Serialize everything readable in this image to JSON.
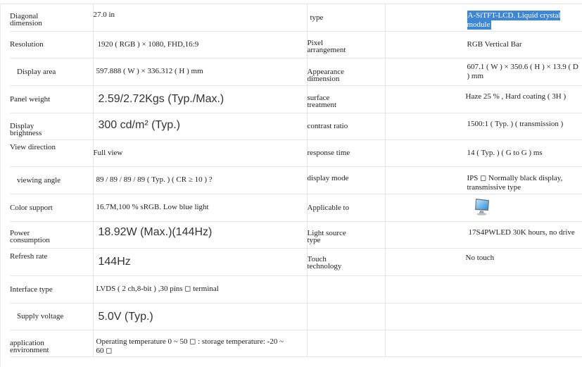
{
  "rows": [
    {
      "k1": "Diagonal\ndimension",
      "v2": "27.0 in",
      "k3": "type",
      "v4": "A-SiTFT-LCD. Liquid crystal module"
    },
    {
      "k1": "Resolution",
      "v2": "1920 ( RGB ) × 1080, FHD,16:9",
      "k3": "Pixel\narrangement",
      "v4": "RGB Vertical Bar"
    },
    {
      "k1": "Display area",
      "v2": "597.888 ( W ) × 336.312 ( H ) mm",
      "k3": "Appearance\ndimension",
      "v4": "607.1 ( W ) × 350.6 ( H ) × 13.9 ( D ) mm"
    },
    {
      "k1": "Panel weight",
      "v2": "2.59/2.72Kgs (Typ./Max.)",
      "k3": "surface\ntreatment",
      "v4": "Haze 25 % , Hard coating ( 3H )"
    },
    {
      "k1": "Display\nbrightness",
      "v2": "300 cd/m² (Typ.)",
      "k3": "contrast ratio",
      "v4": "1500:1 ( Typ. ) ( transmission )"
    },
    {
      "k1": "View direction",
      "v2": "Full view",
      "k3": "response time",
      "v4": "14 ( Typ. ) ( G to G ) ms"
    },
    {
      "k1": "viewing angle",
      "v2": "89 / 89 / 89 / 89 ( Typ. ) ( CR ≥ 10 ) ?",
      "k3": "display mode",
      "v4": "IPS ◻ Normally black display,\ntransmissive type"
    },
    {
      "k1": "Color support",
      "v2": "16.7M,100 % sRGB. Low blue light",
      "k3": "Applicable to",
      "v4": ""
    },
    {
      "k1": "Power\nconsumption",
      "v2": "18.92W (Max.)(144Hz)",
      "k3": "Light source\ntype",
      "v4": "17S4PWLED 30K hours, no drive"
    },
    {
      "k1": "Refresh rate",
      "v2": "144Hz",
      "k3": "Touch\ntechnology",
      "v4": "No touch"
    },
    {
      "k1": "Interface type",
      "v2": "LVDS ( 2 ch,8-bit ) ,30 pins ◻ terminal",
      "k3": "",
      "v4": ""
    },
    {
      "k1": "Supply voltage",
      "v2": "5.0V (Typ.)",
      "k3": "",
      "v4": ""
    },
    {
      "k1": "application\nenvironment",
      "v2": "Operating temperature 0 ~ 50 ◻ : storage temperature: -20 ~\n60 ◻",
      "k3": "",
      "v4": ""
    }
  ],
  "icons": {
    "applicable": "monitor-icon"
  },
  "colors": {
    "highlight": "#3e86d6",
    "border": "#e6e6e6"
  }
}
